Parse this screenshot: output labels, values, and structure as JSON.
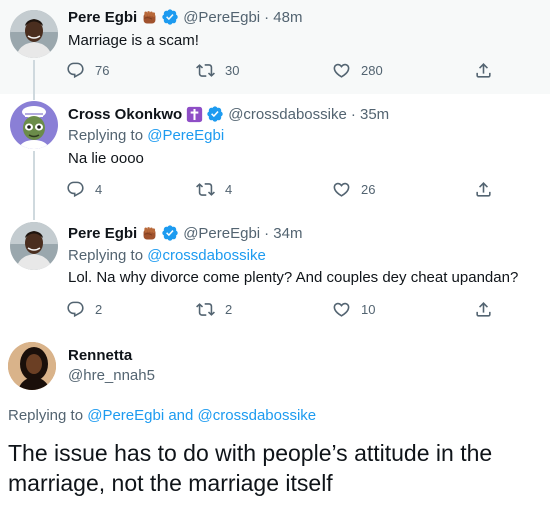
{
  "tweets": [
    {
      "name": "Pere Egbi",
      "handle": "@PereEgbi",
      "time": "· 48m",
      "replying_prefix": "",
      "replying_to": "",
      "text": "Marriage is a scam!",
      "replies": "76",
      "retweets": "30",
      "likes": "280"
    },
    {
      "name": "Cross Okonkwo",
      "handle": "@crossdabossike",
      "time": "· 35m",
      "replying_prefix": "Replying to",
      "replying_to": "@PereEgbi",
      "text": "Na lie oooo",
      "replies": "4",
      "retweets": "4",
      "likes": "26"
    },
    {
      "name": "Pere Egbi",
      "handle": "@PereEgbi",
      "time": "· 34m",
      "replying_prefix": "Replying to",
      "replying_to": "@crossdabossike",
      "text": "Lol. Na why divorce come plenty? And couples dey cheat upandan?",
      "replies": "2",
      "retweets": "2",
      "likes": "10"
    }
  ],
  "main_tweet": {
    "name": "Rennetta",
    "handle": "@hre_nnah5",
    "replying_prefix": "Replying to",
    "mention_1": "@PereEgbi",
    "and_word": "and",
    "mention_2": "@crossdabossike",
    "text": "The issue has to do with people’s attitude in the marriage, not the marriage itself"
  },
  "icons": {
    "reply": "reply-icon",
    "retweet": "retweet-icon",
    "like": "heart-icon",
    "share": "share-icon",
    "verified": "verified-badge-icon",
    "fist": "raised-fist-emoji-icon",
    "cross": "latin-cross-emoji-icon"
  },
  "colors": {
    "link": "#1d9bf0",
    "secondary_text": "#536471",
    "highlight_bg": "#f7f9f9",
    "thread_line": "#cfd9de",
    "cross_badge": "#8e4ec6"
  }
}
